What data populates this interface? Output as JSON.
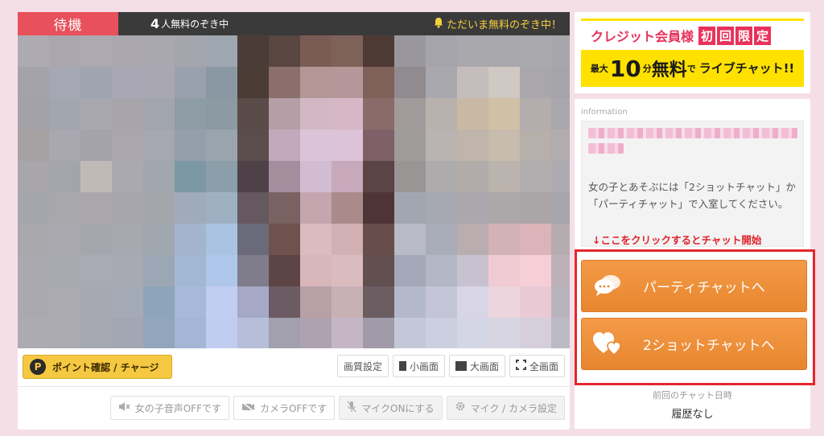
{
  "status": {
    "state": "待機",
    "viewer_count": "4",
    "viewer_text": "人無料のぞき中",
    "free_notice": "ただいま無料のぞき中！"
  },
  "video": {
    "pixel_colors": [
      [
        "#aeaab2",
        "#aaa6ae",
        "#aca9b1",
        "#aaa7b0",
        "#a9a7b0",
        "#a4a5ad",
        "#9ea6af",
        "#4b3c37",
        "#594641",
        "#7a5c54",
        "#7e625a",
        "#4e3a34",
        "#99979d",
        "#a5a4aa",
        "#a9a8ad",
        "#a8a7ac",
        "#aaa9ae",
        "#a7a6ab"
      ],
      [
        "#a4a3ab",
        "#a5a8b3",
        "#9fa5b0",
        "#a8a7b3",
        "#a9a8b2",
        "#98a1ad",
        "#8a98a4",
        "#4b3b35",
        "#8a6f6b",
        "#b39796",
        "#b59799",
        "#7f615a",
        "#8f8b8f",
        "#a8a8ae",
        "#c4bdbc",
        "#d0c8c2",
        "#a9a7ac",
        "#a5a4a9"
      ],
      [
        "#a3a2a9",
        "#a1a6af",
        "#a9a8b0",
        "#a7a4ac",
        "#a3a5ae",
        "#8e9ca5",
        "#8c9aa3",
        "#5a4b48",
        "#b59ea6",
        "#d3b8c3",
        "#d7b7c5",
        "#8a6b6a",
        "#a19b9b",
        "#b8b1ad",
        "#c8b8a4",
        "#d0c0a6",
        "#b3adae",
        "#aaa7ac"
      ],
      [
        "#a6a1a3",
        "#a9a7b0",
        "#a4a3ab",
        "#a9a6af",
        "#a6a7b0",
        "#93a0ab",
        "#9aa4ac",
        "#5b4d4c",
        "#c2a9bb",
        "#dbc4d8",
        "#dcc3d7",
        "#7f6068",
        "#a09b9b",
        "#b9b3b1",
        "#bfb5aa",
        "#c7bcad",
        "#b7afa9",
        "#b1acad"
      ],
      [
        "#a9a6ab",
        "#a4a4ab",
        "#c0bab6",
        "#aaa9b0",
        "#a1a7af",
        "#7c98a6",
        "#8b9ea9",
        "#4e4248",
        "#a48e9e",
        "#d2bcd1",
        "#c8a9bc",
        "#5b4346",
        "#9a9595",
        "#aeabad",
        "#b1aca9",
        "#bbb3ad",
        "#b2adaf",
        "#aeabb0"
      ],
      [
        "#a5a6ab",
        "#a8a7ac",
        "#a9a7ac",
        "#a7a6ac",
        "#a4a6ac",
        "#a0abba",
        "#9fb0c3",
        "#65585f",
        "#7a6262",
        "#c4a6ae",
        "#ab8a8c",
        "#4e3436",
        "#a2a6b0",
        "#a7a9b2",
        "#aba8ad",
        "#aca7a9",
        "#aaa6a8",
        "#a7a6aa"
      ],
      [
        "#a9a8ad",
        "#aaa9af",
        "#a4a7ae",
        "#a7a8b0",
        "#a1a7ae",
        "#a4b4ce",
        "#abc3e3",
        "#6b6a7b",
        "#6f524e",
        "#dcbac0",
        "#d2b0b3",
        "#674e4c",
        "#b9bbc6",
        "#a9adba",
        "#b9adb0",
        "#d2b2b6",
        "#dcb3b8",
        "#b5acb2"
      ],
      [
        "#aaa9af",
        "#a8aab0",
        "#a8aab4",
        "#a7a9b3",
        "#9ba7b4",
        "#a2b7d3",
        "#aec6ea",
        "#7f7c8c",
        "#5e4545",
        "#d8b6b9",
        "#dabcbf",
        "#625050",
        "#a3a9b9",
        "#b4b7c6",
        "#c8c2d0",
        "#f0cbd3",
        "#f6ced6",
        "#bdb0b8"
      ],
      [
        "#aaa9af",
        "#aaaab0",
        "#a7a9b2",
        "#a4aab6",
        "#8ea5b9",
        "#a6b9d8",
        "#c1cdf1",
        "#a5a9c6",
        "#6d5b63",
        "#b7a0a6",
        "#c9b0b5",
        "#6c5d63",
        "#b3b8ca",
        "#c3c5d6",
        "#d8d5e6",
        "#ecd5dd",
        "#e9cad4",
        "#b9b3be"
      ],
      [
        "#acabb1",
        "#aaaab0",
        "#a6a8b2",
        "#a3a7b3",
        "#93a5ba",
        "#a3b6d5",
        "#c1cdf0",
        "#b7bed9",
        "#a29faf",
        "#aea2b0",
        "#c4b6c5",
        "#a19ba9",
        "#c3c8d8",
        "#cbcfdf",
        "#d4d5e5",
        "#d8d5e2",
        "#d4cfdb",
        "#bcbac4"
      ]
    ]
  },
  "controls": {
    "point_icon": "P",
    "point_label": "ポイント確認 / チャージ",
    "quality_label": "画質設定",
    "small_screen_label": "小画面",
    "large_screen_label": "大画面",
    "full_screen_label": "全画面",
    "girl_audio_label": "女の子音声OFFです",
    "camera_label": "カメラOFFです",
    "mic_label": "マイクONにする",
    "mic_camera_settings_label": "マイク / カメラ設定"
  },
  "banner": {
    "member_text": "クレジット会員様",
    "limited_chars": [
      "初",
      "回",
      "限",
      "定"
    ],
    "max_text": "最大",
    "minutes_num": "10",
    "minutes_unit": "分",
    "free_text": "無料",
    "de_text": "で",
    "live_chat_text": "ライブチャット!!"
  },
  "info": {
    "label": "information",
    "description": "女の子とあそぶには「2ショットチャット」か「パーティチャット」で入室してください。",
    "click_hint": "↓ここをクリックするとチャット開始"
  },
  "chat": {
    "party_label": "パーティチャットへ",
    "twoshot_label": "2ショットチャットへ"
  },
  "history": {
    "label": "前回のチャット日時",
    "value": "履歴なし"
  },
  "colors": {
    "standby_red": "#e8505b",
    "status_bar": "#3a3a3a",
    "notice_yellow": "#f4d03f",
    "point_yellow": "#f5c842",
    "chat_orange": "#ec8c35",
    "highlight_red": "#e6262d",
    "hint_red": "#e0242d",
    "banner_pink": "#e8335b",
    "banner_yellow": "#ffe100",
    "background_pink": "#f5dfe6"
  }
}
